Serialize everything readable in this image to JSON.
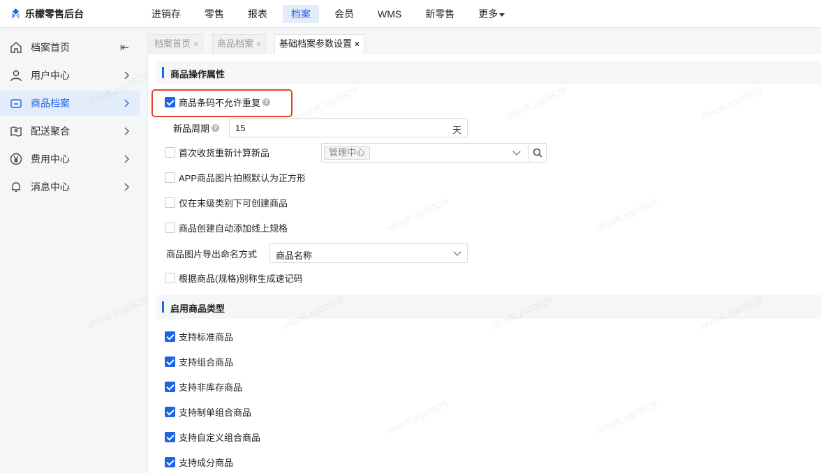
{
  "app": {
    "title": "乐檬零售后台"
  },
  "topnav": [
    {
      "label": "进销存"
    },
    {
      "label": "零售"
    },
    {
      "label": "报表"
    },
    {
      "label": "档案",
      "active": true
    },
    {
      "label": "会员"
    },
    {
      "label": "WMS"
    },
    {
      "label": "新零售"
    },
    {
      "label": "更多"
    }
  ],
  "sidebar": {
    "items": [
      {
        "label": "档案首页",
        "icon": "home-icon"
      },
      {
        "label": "用户中心",
        "icon": "user-icon"
      },
      {
        "label": "商品档案",
        "icon": "product-icon",
        "active": true
      },
      {
        "label": "配送聚合",
        "icon": "map-icon"
      },
      {
        "label": "费用中心",
        "icon": "yen-icon"
      },
      {
        "label": "消息中心",
        "icon": "bell-icon"
      }
    ]
  },
  "tabs": [
    {
      "label": "档案首页",
      "close": "×"
    },
    {
      "label": "商品档案",
      "close": "×"
    },
    {
      "label": "基础档案参数设置",
      "close": "×",
      "active": true
    }
  ],
  "sections": {
    "product_attrs": {
      "title": "商品操作属性",
      "barcode_unique": {
        "label": "商品条码不允许重复",
        "checked": true,
        "help": "?"
      },
      "new_period": {
        "label": "新品周期",
        "help": "?",
        "value": "15",
        "unit": "天"
      },
      "first_receipt": {
        "label": "首次收货重新计算新品",
        "checked": false,
        "tag": "管理中心"
      },
      "app_square": {
        "label": "APP商品图片拍照默认为正方形",
        "checked": false
      },
      "leaf_only": {
        "label": "仅在末级类别下可创建商品",
        "checked": false
      },
      "auto_spec": {
        "label": "商品创建自动添加线上规格",
        "checked": false
      },
      "img_naming": {
        "label": "商品图片导出命名方式",
        "value": "商品名称"
      },
      "quick_code": {
        "label": "根据商品(规格)别称生成速记码",
        "checked": false
      }
    },
    "product_types": {
      "title": "启用商品类型",
      "items": [
        {
          "label": "支持标准商品",
          "checked": true
        },
        {
          "label": "支持组合商品",
          "checked": true
        },
        {
          "label": "支持非库存商品",
          "checked": true
        },
        {
          "label": "支持制单组合商品",
          "checked": true
        },
        {
          "label": "支持自定义组合商品",
          "checked": true
        },
        {
          "label": "支持成分商品",
          "checked": true
        }
      ]
    }
  },
  "watermark": "nhsoft.zqc0829",
  "colors": {
    "accent": "#1e64e6",
    "highlight": "#e0432e"
  }
}
